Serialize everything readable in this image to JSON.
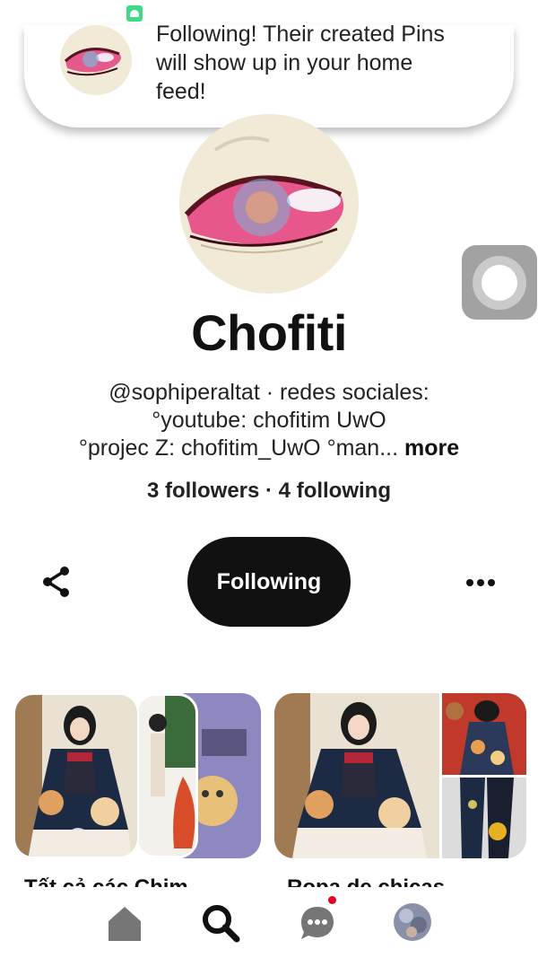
{
  "toast": {
    "message": "Following! Their created Pins will show up in your home feed!"
  },
  "profile": {
    "name": "Chofiti",
    "bio_line1": "@sophiperaltat · redes sociales:",
    "bio_line2": "°youtube:  chofitim UwO",
    "bio_line3": "°projec Z: chofitim_UwO        °man...",
    "more_label": "more",
    "followers_text": "3 followers · 4 following"
  },
  "actions": {
    "following_label": "Following",
    "share_icon": "share-icon",
    "more_icon": "more-options-icon"
  },
  "boards": [
    {
      "title": "Tất cả các Chim"
    },
    {
      "title": "Ropa de chicas"
    }
  ],
  "nav": {
    "home_icon": "home-icon",
    "search_icon": "search-icon",
    "messages_icon": "chat-bubble-icon",
    "profile_icon": "profile-avatar",
    "notification_color": "#e60023"
  },
  "colors": {
    "primary_button": "#111111",
    "accent_green": "#3ddc84"
  }
}
